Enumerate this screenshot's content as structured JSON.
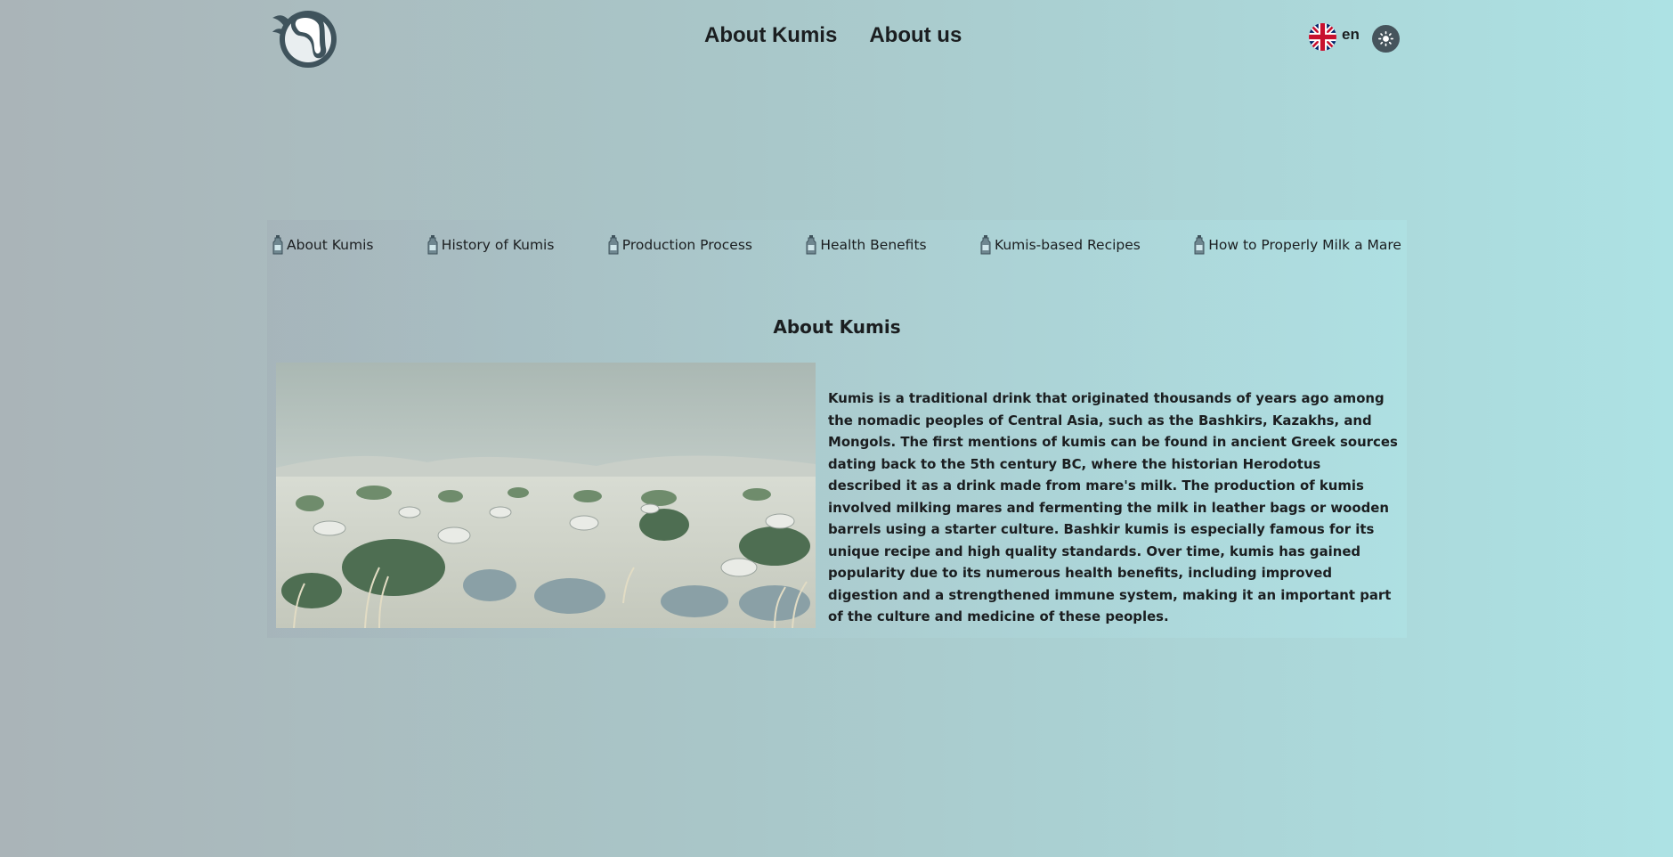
{
  "header": {
    "logo_icon": "horse-head-logo-icon",
    "nav": [
      {
        "label": "About Kumis"
      },
      {
        "label": "About us"
      }
    ],
    "language": {
      "code": "en",
      "flag_icon": "uk-flag-icon"
    },
    "theme_toggle_icon": "sun-icon"
  },
  "subnav": {
    "item_icon": "bottle-icon",
    "items": [
      {
        "label": "About Kumis"
      },
      {
        "label": "History of Kumis"
      },
      {
        "label": "Production Process"
      },
      {
        "label": "Health Benefits"
      },
      {
        "label": "Kumis-based Recipes"
      },
      {
        "label": "How to Properly Milk a Mare"
      }
    ]
  },
  "section": {
    "title": "About Kumis",
    "image_icon": "steppe-horses-image",
    "body": "Kumis is a traditional drink that originated thousands of years ago among the nomadic peoples of Central Asia, such as the Bashkirs, Kazakhs, and Mongols. The first mentions of kumis can be found in ancient Greek sources dating back to the 5th century BC, where the historian Herodotus described it as a drink made from mare's milk. The production of kumis involved milking mares and fermenting the milk in leather bags or wooden barrels using a starter culture. Bashkir kumis is especially famous for its unique recipe and high quality standards. Over time, kumis has gained popularity due to its numerous health benefits, including improved digestion and a strengthened immune system, making it an important part of the culture and medicine of these peoples."
  },
  "colors": {
    "text": "#1b1e20",
    "logo": "#3f535c",
    "theme_button": "#46545c"
  }
}
